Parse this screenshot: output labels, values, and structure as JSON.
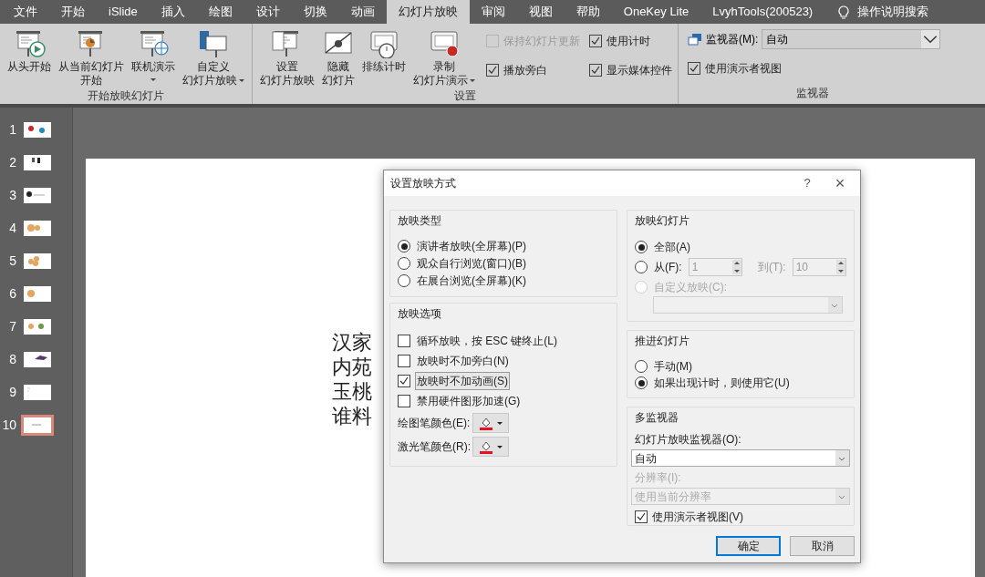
{
  "tabs": [
    {
      "label": "文件",
      "selected": false
    },
    {
      "label": "开始",
      "selected": false
    },
    {
      "label": "iSlide",
      "selected": false
    },
    {
      "label": "插入",
      "selected": false
    },
    {
      "label": "绘图",
      "selected": false
    },
    {
      "label": "设计",
      "selected": false
    },
    {
      "label": "切换",
      "selected": false
    },
    {
      "label": "动画",
      "selected": false
    },
    {
      "label": "幻灯片放映",
      "selected": true
    },
    {
      "label": "审阅",
      "selected": false
    },
    {
      "label": "视图",
      "selected": false
    },
    {
      "label": "帮助",
      "selected": false
    },
    {
      "label": "OneKey Lite",
      "selected": false
    },
    {
      "label": "LvyhTools(200523)",
      "selected": false
    }
  ],
  "search": {
    "label": "操作说明搜索"
  },
  "ribbon_groups": [
    {
      "label": "开始放映幻灯片",
      "items": [
        {
          "kind": "big",
          "lines": [
            "从头开始"
          ],
          "dropdown": false
        },
        {
          "kind": "big",
          "lines": [
            "从当前幻灯片",
            "开始"
          ],
          "dropdown": false
        },
        {
          "kind": "big",
          "lines": [
            "联机演示"
          ],
          "dropdown": true
        },
        {
          "kind": "big",
          "lines": [
            "自定义",
            "幻灯片放映"
          ],
          "dropdown": true
        }
      ]
    },
    {
      "label": "设置",
      "items": [
        {
          "kind": "big",
          "lines": [
            "设置",
            "幻灯片放映"
          ],
          "dropdown": false
        },
        {
          "kind": "big",
          "lines": [
            "隐藏",
            "幻灯片"
          ],
          "dropdown": false
        },
        {
          "kind": "big",
          "lines": [
            "排练计时"
          ],
          "dropdown": false
        },
        {
          "kind": "big",
          "lines": [
            "录制",
            "幻灯片演示"
          ],
          "dropdown": true
        },
        {
          "kind": "checks",
          "checks": [
            {
              "label": "保持幻灯片更新",
              "checked": false,
              "disabled": true
            },
            {
              "label": "播放旁白",
              "checked": true,
              "disabled": false
            }
          ]
        },
        {
          "kind": "checks",
          "checks": [
            {
              "label": "使用计时",
              "checked": true,
              "disabled": false
            },
            {
              "label": "显示媒体控件",
              "checked": true,
              "disabled": false
            }
          ]
        }
      ]
    },
    {
      "label": "监视器",
      "items": [
        {
          "kind": "monitor",
          "label": "监视器(M):",
          "value": "自动",
          "checks": [
            {
              "label": "使用演示者视图",
              "checked": true,
              "disabled": false
            }
          ]
        }
      ]
    }
  ],
  "slides": [
    {
      "number": "1",
      "selected": false
    },
    {
      "number": "2",
      "selected": false
    },
    {
      "number": "3",
      "selected": false
    },
    {
      "number": "4",
      "selected": false
    },
    {
      "number": "5",
      "selected": false
    },
    {
      "number": "6",
      "selected": false
    },
    {
      "number": "7",
      "selected": false
    },
    {
      "number": "8",
      "selected": false
    },
    {
      "number": "9",
      "selected": false
    },
    {
      "number": "10",
      "selected": true
    }
  ],
  "slide_text": [
    "汉家",
    "内苑",
    "玉桃",
    "谁料"
  ],
  "dialog": {
    "title": "设置放映方式",
    "help": "?",
    "close": "×",
    "show_type": {
      "title": "放映类型",
      "options": [
        {
          "label": "演讲者放映(全屏幕)(P)",
          "selected": true
        },
        {
          "label": "观众自行浏览(窗口)(B)",
          "selected": false
        },
        {
          "label": "在展台浏览(全屏幕)(K)",
          "selected": false
        }
      ]
    },
    "show_options": {
      "title": "放映选项",
      "checks": [
        {
          "label": "循环放映，按 ESC 键终止(L)",
          "checked": false,
          "focused": false
        },
        {
          "label": "放映时不加旁白(N)",
          "checked": false,
          "focused": false
        },
        {
          "label": "放映时不加动画(S)",
          "checked": true,
          "focused": true
        },
        {
          "label": "禁用硬件图形加速(G)",
          "checked": false,
          "focused": false
        }
      ],
      "pens": [
        {
          "label": "绘图笔颜色(E):",
          "color": "#e81123"
        },
        {
          "label": "激光笔颜色(R):",
          "color": "#e81123"
        }
      ]
    },
    "show_slides": {
      "title": "放映幻灯片",
      "all": {
        "label": "全部(A)",
        "selected": true
      },
      "from": {
        "label": "从(F):",
        "selected": false,
        "value": "1"
      },
      "to": {
        "label": "到(T):",
        "value": "10"
      },
      "custom": {
        "label": "自定义放映(C):",
        "selected": false,
        "disabled": true
      }
    },
    "advance": {
      "title": "推进幻灯片",
      "options": [
        {
          "label": "手动(M)",
          "selected": false
        },
        {
          "label": "如果出现计时，则使用它(U)",
          "selected": true
        }
      ]
    },
    "monitors": {
      "title": "多监视器",
      "monitor_label": "幻灯片放映监视器(O):",
      "monitor_value": "自动",
      "resolution_label": "分辨率(I):",
      "resolution_value": "使用当前分辨率",
      "resolution_disabled": true,
      "presenter": {
        "label": "使用演示者视图(V)",
        "checked": true
      }
    },
    "buttons": [
      {
        "label": "确定",
        "default": true
      },
      {
        "label": "取消",
        "default": false
      }
    ]
  }
}
